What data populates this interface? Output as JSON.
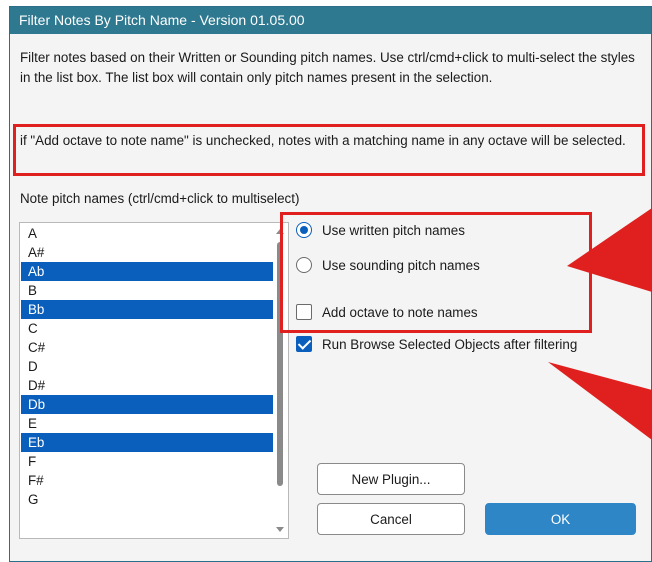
{
  "window": {
    "title": "Filter Notes By Pitch Name - Version 01.05.00"
  },
  "description": "Filter notes based on their Written or Sounding pitch names. Use ctrl/cmd+click to multi-select the styles in the list box. The list box will contain only pitch names present in the selection.",
  "note": "if \"Add octave to note name\" is unchecked, notes with a matching name in any octave will be selected.",
  "list": {
    "label": "Note pitch names (ctrl/cmd+click to multiselect)",
    "items": [
      {
        "label": "A",
        "selected": false
      },
      {
        "label": "A#",
        "selected": false
      },
      {
        "label": "Ab",
        "selected": true
      },
      {
        "label": "B",
        "selected": false
      },
      {
        "label": "Bb",
        "selected": true
      },
      {
        "label": "C",
        "selected": false
      },
      {
        "label": "C#",
        "selected": false
      },
      {
        "label": "D",
        "selected": false
      },
      {
        "label": "D#",
        "selected": false
      },
      {
        "label": "Db",
        "selected": true
      },
      {
        "label": "E",
        "selected": false
      },
      {
        "label": "Eb",
        "selected": true
      },
      {
        "label": "F",
        "selected": false
      },
      {
        "label": "F#",
        "selected": false
      },
      {
        "label": "G",
        "selected": false
      }
    ]
  },
  "options": {
    "written_label": "Use written pitch names",
    "written_checked": true,
    "sounding_label": "Use sounding pitch names",
    "sounding_checked": false,
    "octave_label": "Add octave to note names",
    "octave_checked": false,
    "browse_label": "Run Browse Selected Objects after filtering",
    "browse_checked": true
  },
  "buttons": {
    "new_plugin": "New Plugin...",
    "cancel": "Cancel",
    "ok": "OK"
  },
  "colors": {
    "titlebar": "#2e7890",
    "selection": "#0a5fbd",
    "highlight_box": "#e0201e",
    "arrow": "#e0201e",
    "ok_button": "#2f86c6"
  }
}
